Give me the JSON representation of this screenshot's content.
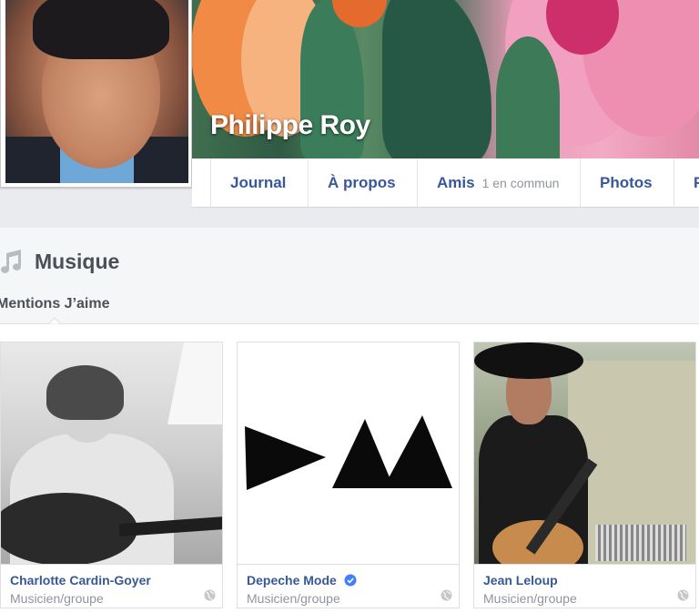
{
  "profile": {
    "name": "Philippe Roy"
  },
  "nav": {
    "journal": "Journal",
    "apropos": "À propos",
    "amis": "Amis",
    "amis_sub": "1 en commun",
    "photos": "Photos",
    "more": "F"
  },
  "section": {
    "title": "Musique",
    "icon": "music-note-icon",
    "subtab": "Mentions J’aime"
  },
  "cards": [
    {
      "name": "Charlotte Cardin-Goyer",
      "category": "Musicien/groupe",
      "verified": false
    },
    {
      "name": "Depeche Mode",
      "category": "Musicien/groupe",
      "verified": true
    },
    {
      "name": "Jean Leloup",
      "category": "Musicien/groupe",
      "verified": false
    }
  ],
  "colors": {
    "link": "#365899",
    "muted": "#90949c",
    "header_bg": "#f5f6f7",
    "verified": "#4080ff"
  }
}
